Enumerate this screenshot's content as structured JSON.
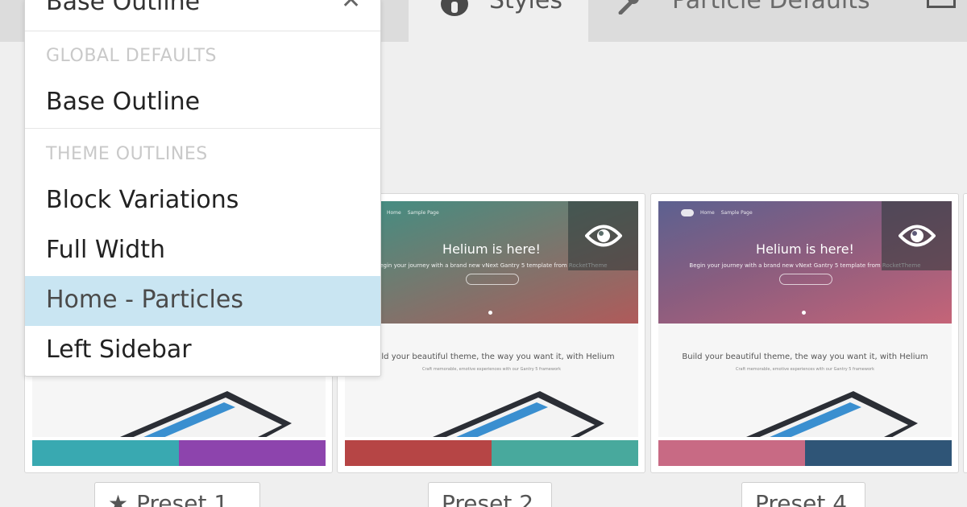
{
  "tabs": [
    {
      "label": "Styles",
      "icon": "globe-icon",
      "active": true
    },
    {
      "label": "Particle Defaults",
      "icon": "wrench-icon",
      "active": false
    },
    {
      "label": "",
      "icon": "keyboard-icon",
      "active": false
    }
  ],
  "dropdown": {
    "current_value": "Base Outline",
    "clear_icon": "close-icon",
    "groups": [
      {
        "label": "GLOBAL DEFAULTS",
        "items": [
          "Base Outline"
        ]
      },
      {
        "label": "THEME OUTLINES",
        "items": [
          "Block Variations",
          "Full Width",
          "Home - Particles",
          "Left Sidebar"
        ]
      }
    ],
    "highlighted": "Home - Particles"
  },
  "presets": [
    {
      "label": "Preset 1",
      "icon": "star-icon",
      "swatches": [
        "#39a9b1",
        "#8d44ad"
      ]
    },
    {
      "label": "Preset 2",
      "hero_title": "Helium is here!",
      "hero_sub": "Begin your journey with a brand new vNext Gantry 5 template from RocketTheme",
      "body_title": "Build your beautiful theme, the way you want it, with Helium",
      "body_sub": "Craft memorable, emotive experiences with our Gantry 5 framework",
      "nav": [
        "Home",
        "Sample Page"
      ],
      "swatches": [
        "#b64545",
        "#48a99d"
      ]
    },
    {
      "label": "Preset 4",
      "hero_title": "Helium is here!",
      "hero_sub": "Begin your journey with a brand new vNext Gantry 5 template from RocketTheme",
      "body_title": "Build your beautiful theme, the way you want it, with Helium",
      "body_sub": "Craft memorable, emotive experiences with our Gantry 5 framework",
      "nav": [
        "Home",
        "Sample Page"
      ],
      "swatches": [
        "#c86a84",
        "#2f5577"
      ]
    }
  ],
  "colors": {
    "highlight": "#c9e5f2",
    "background": "#efefef",
    "tabbar": "#dcdcdc"
  }
}
